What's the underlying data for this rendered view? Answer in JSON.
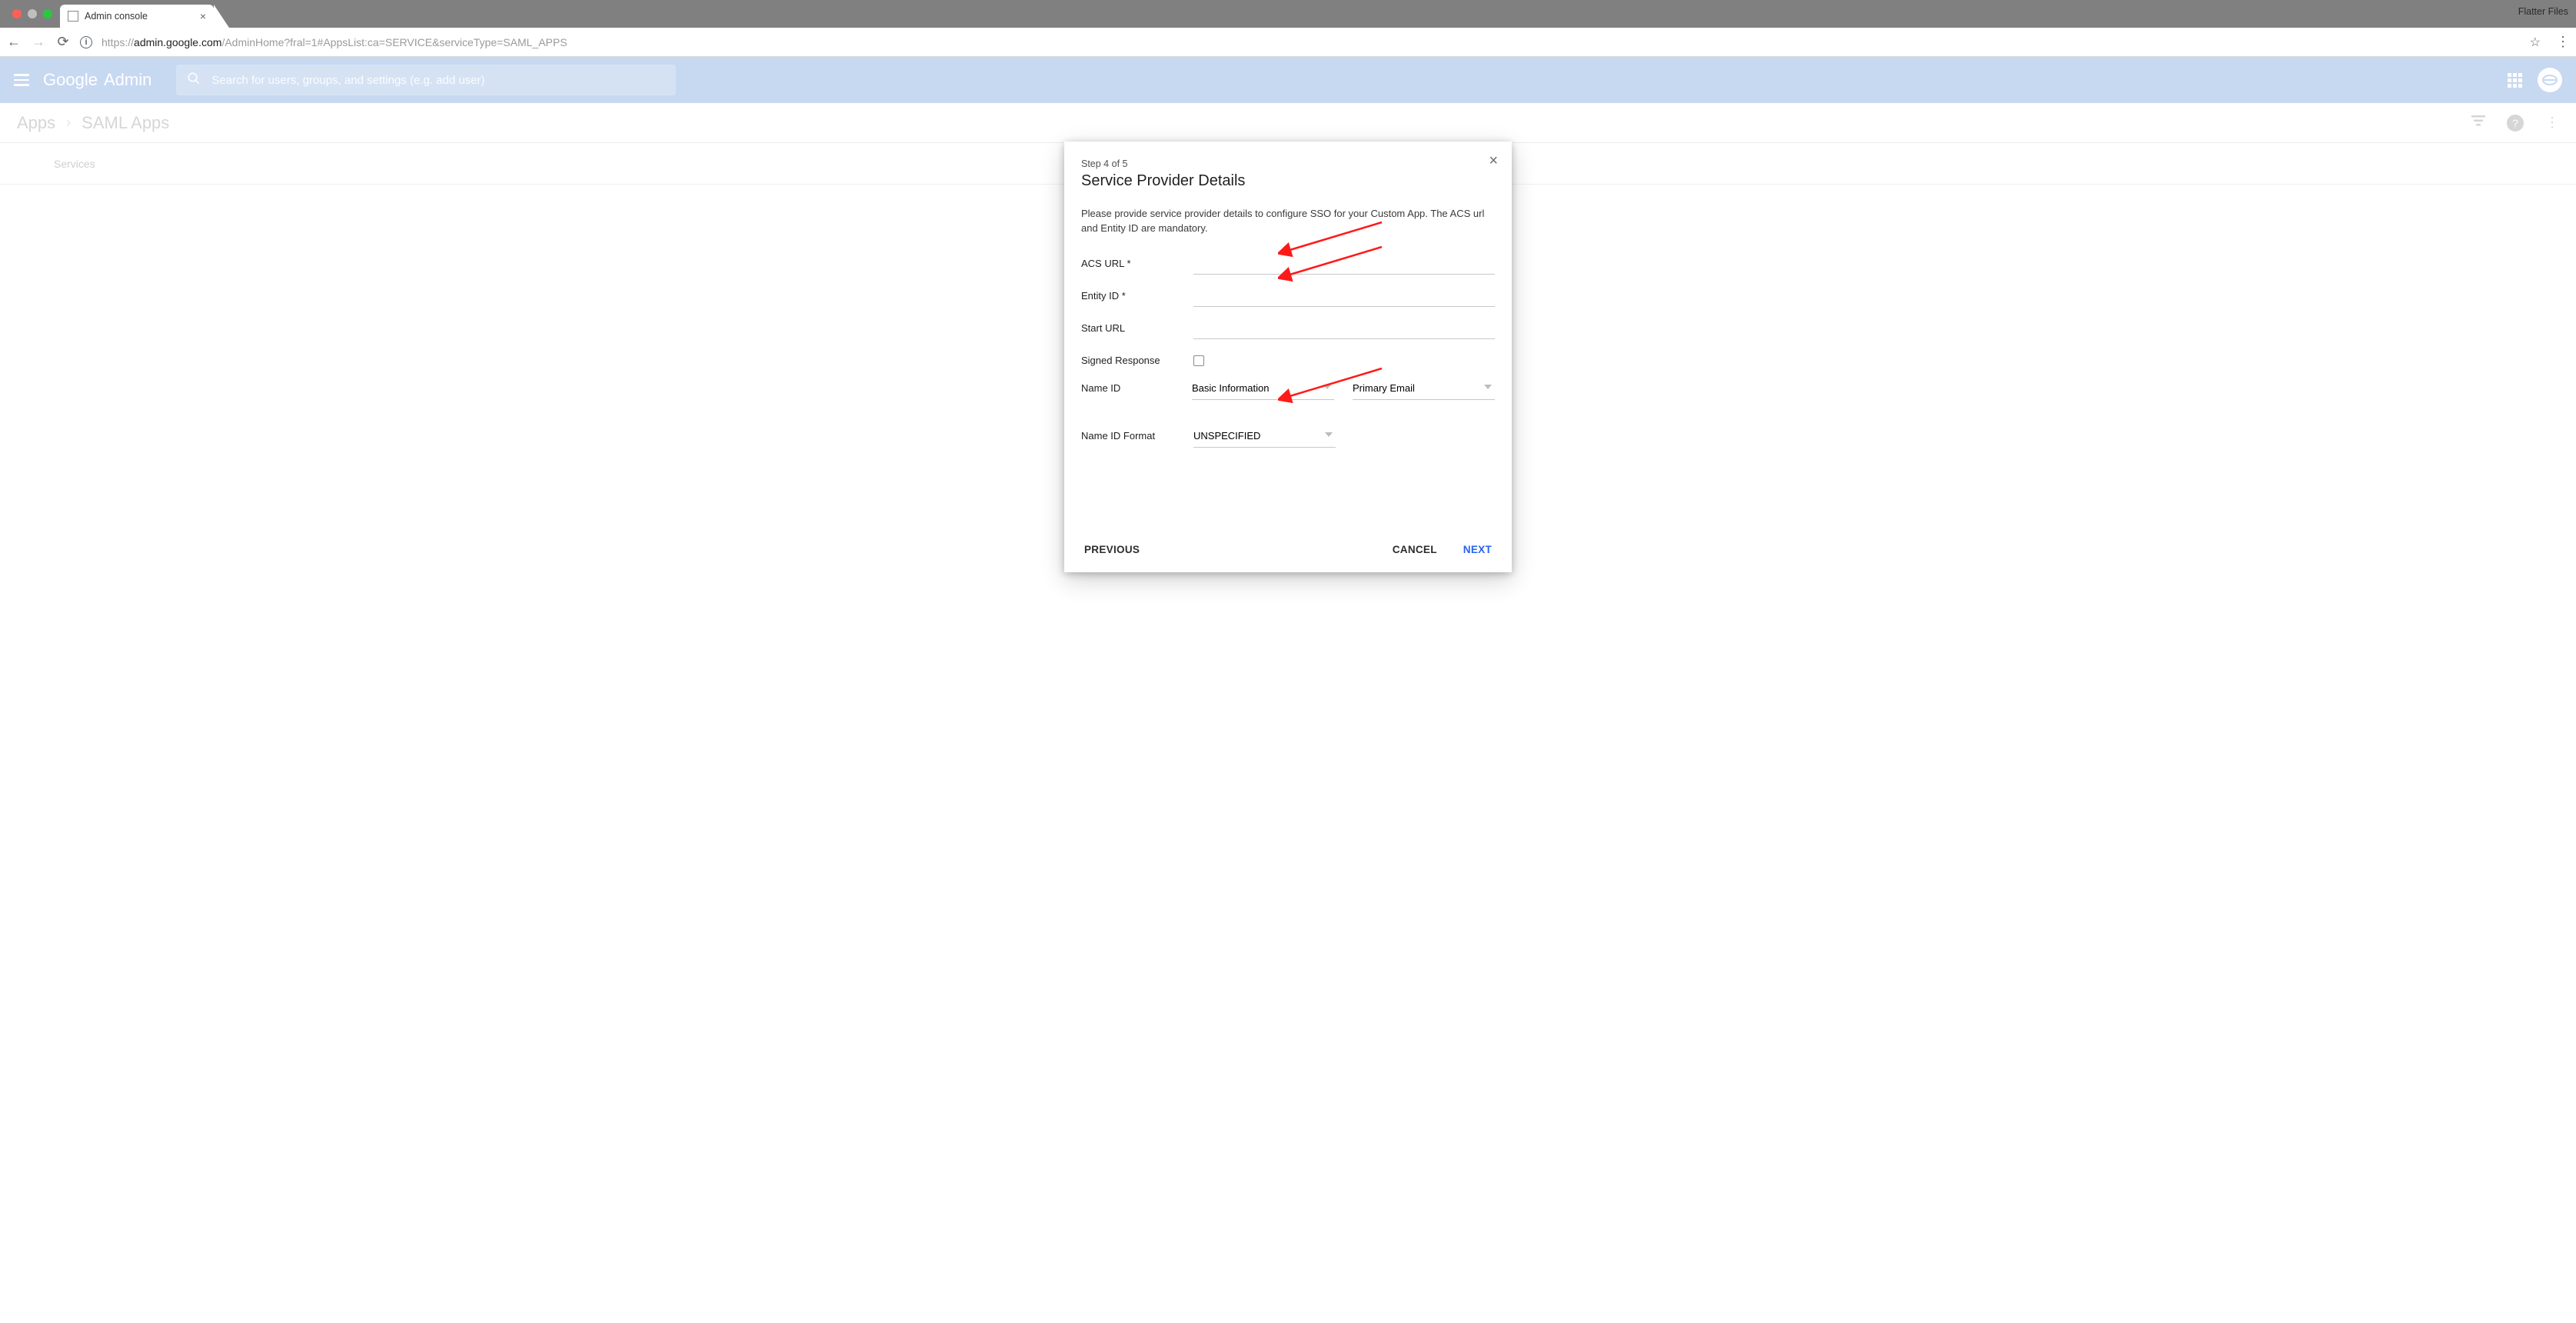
{
  "browser": {
    "tab_title": "Admin console",
    "menu_label": "Flatter Files",
    "url_proto": "https://",
    "url_host": "admin.google.com",
    "url_path": "/AdminHome?fral=1#AppsList:ca=SERVICE&serviceType=SAML_APPS"
  },
  "header": {
    "brand_a": "Google",
    "brand_b": "Admin",
    "search_placeholder": "Search for users, groups, and settings (e.g. add user)"
  },
  "crumbs": {
    "a": "Apps",
    "b": "SAML Apps"
  },
  "services_label": "Services",
  "modal": {
    "step": "Step 4 of 5",
    "title": "Service Provider Details",
    "desc": "Please provide service provider details to configure SSO for your Custom App. The ACS url and Entity ID are mandatory.",
    "fields": {
      "acs": "ACS URL *",
      "entity": "Entity ID *",
      "start": "Start URL",
      "signed": "Signed Response",
      "nameid": "Name ID",
      "nameidfmt": "Name ID Format"
    },
    "selects": {
      "basic": "Basic Information",
      "primary": "Primary Email",
      "fmt": "UNSPECIFIED"
    },
    "actions": {
      "prev": "PREVIOUS",
      "cancel": "CANCEL",
      "next": "NEXT"
    }
  }
}
